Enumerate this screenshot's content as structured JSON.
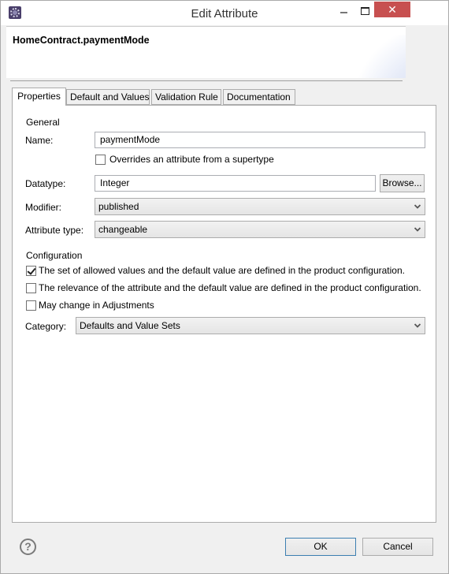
{
  "window": {
    "title": "Edit Attribute",
    "controls": {
      "minimize": "–",
      "maximize": "□",
      "close": "✕"
    }
  },
  "header": {
    "title": "HomeContract.paymentMode"
  },
  "tabs": [
    {
      "label": "Properties",
      "active": true
    },
    {
      "label": "Default and Values",
      "active": false
    },
    {
      "label": "Validation Rule",
      "active": false
    },
    {
      "label": "Documentation",
      "active": false
    }
  ],
  "general": {
    "section_label": "General",
    "name_label": "Name:",
    "name_value": "paymentMode",
    "overrides_label": "Overrides an attribute from a supertype",
    "overrides_checked": false,
    "datatype_label": "Datatype:",
    "datatype_value": "Integer",
    "browse_label": "Browse...",
    "modifier_label": "Modifier:",
    "modifier_value": "published",
    "attribute_type_label": "Attribute type:",
    "attribute_type_value": "changeable"
  },
  "configuration": {
    "section_label": "Configuration",
    "options": [
      {
        "label": "The set of allowed values and the default value are defined in the product configuration.",
        "checked": true
      },
      {
        "label": "The relevance of the attribute and the default value are defined in the product configuration.",
        "checked": false
      },
      {
        "label": "May change in Adjustments",
        "checked": false
      }
    ],
    "category_label": "Category:",
    "category_value": "Defaults and Value Sets"
  },
  "footer": {
    "help_icon": "?",
    "ok_label": "OK",
    "cancel_label": "Cancel"
  }
}
